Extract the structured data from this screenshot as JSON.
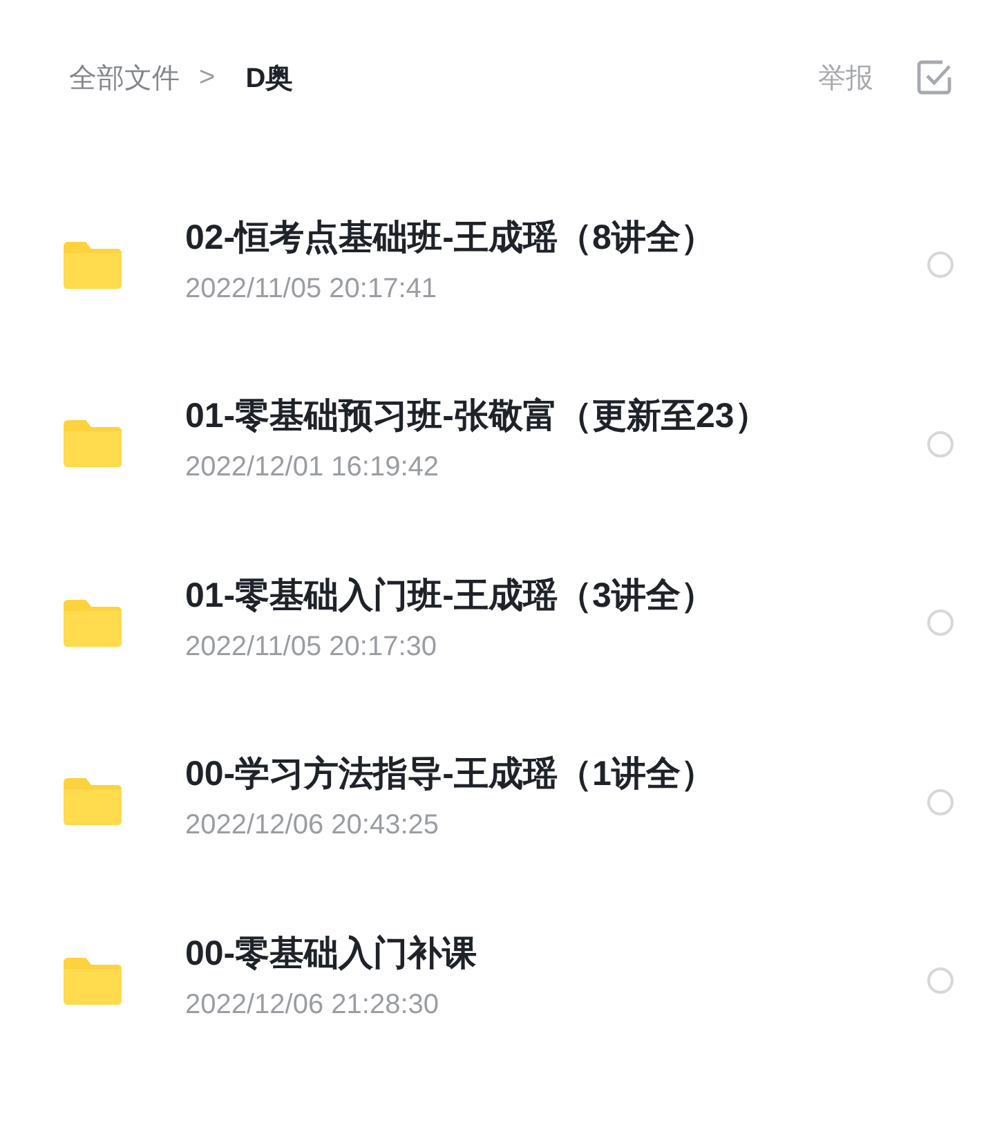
{
  "breadcrumb": {
    "root": "全部文件",
    "separator": ">",
    "current": "D奥"
  },
  "actions": {
    "report": "举报"
  },
  "files": [
    {
      "name": "02-恒考点基础班-王成瑶（8讲全）",
      "date": "2022/11/05 20:17:41",
      "selected": false
    },
    {
      "name": "01-零基础预习班-张敬富（更新至23）",
      "date": "2022/12/01 16:19:42",
      "selected": false
    },
    {
      "name": "01-零基础入门班-王成瑶（3讲全）",
      "date": "2022/11/05 20:17:30",
      "selected": false
    },
    {
      "name": "00-学习方法指导-王成瑶（1讲全）",
      "date": "2022/12/06 20:43:25",
      "selected": false
    },
    {
      "name": "00-零基础入门补课",
      "date": "2022/12/06 21:28:30",
      "selected": false
    }
  ]
}
